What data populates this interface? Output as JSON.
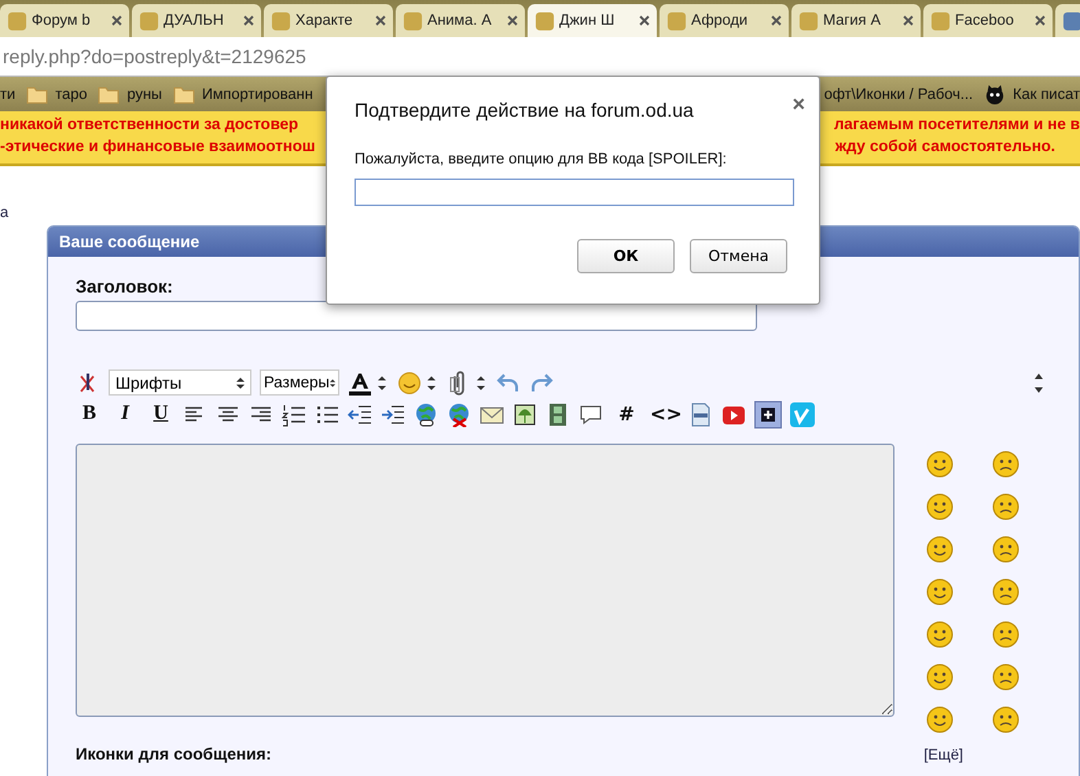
{
  "tabs": [
    {
      "label": "Форум b",
      "selected": false
    },
    {
      "label": "ДУАЛЬН",
      "selected": false
    },
    {
      "label": "Характе",
      "selected": false
    },
    {
      "label": "Анима. А",
      "selected": false
    },
    {
      "label": "Джин Ш",
      "selected": true
    },
    {
      "label": "Афроди",
      "selected": false
    },
    {
      "label": "Магия А",
      "selected": false
    },
    {
      "label": "Faceboo",
      "selected": false
    }
  ],
  "address": "reply.php?do=postreply&t=2129625",
  "bookmarks": [
    {
      "label": "ти",
      "kind": "plain"
    },
    {
      "label": "таро",
      "kind": "folder"
    },
    {
      "label": "руны",
      "kind": "folder"
    },
    {
      "label": "Импортированн",
      "kind": "folder"
    }
  ],
  "bookmarks_right": [
    {
      "label": "офт\\Иконки / Рабоч...",
      "kind": "plain"
    },
    {
      "label": "Как писат",
      "kind": "cat"
    }
  ],
  "notice": [
    {
      "left": "никакой ответственности за достовер",
      "right": "лагаемым посетителями и не в"
    },
    {
      "left": "-этические и финансовые взаимоотнош",
      "right": "жду собой самостоятельно."
    }
  ],
  "breadcrumb_link": "а",
  "panel": {
    "title": "Ваше сообщение",
    "subject_label": "Заголовок:",
    "font_select": "Шрифты",
    "size_select": "Размеры",
    "format_buttons": [
      "B",
      "I",
      "U"
    ],
    "code_buttons": [
      "#",
      "<>"
    ],
    "icons_label": "Иконки для сообщения:",
    "more_link": "[Ещё]"
  },
  "dialog": {
    "title": "Подтвердите действие на forum.od.ua",
    "close": "×",
    "prompt": "Пожалуйста, введите опцию для BB кода [SPOILER]:",
    "ok": "ОК",
    "cancel": "Отмена"
  }
}
